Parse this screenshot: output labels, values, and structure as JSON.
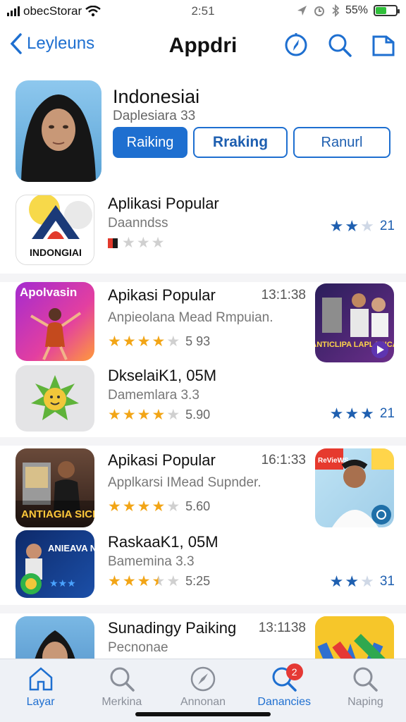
{
  "status": {
    "carrier": "obecStorar",
    "time": "2:51",
    "battery": "55%"
  },
  "nav": {
    "back_label": "Leyleuns",
    "title": "Appdri",
    "icons": [
      "compass-icon",
      "search-icon",
      "share-icon"
    ]
  },
  "hero": {
    "name": "Indonesiai",
    "subtitle": "Daplesiara 33",
    "buttons": [
      "Raiking",
      "Rraking",
      "Ranurl"
    ]
  },
  "rows": [
    {
      "icon_text": "INDONGIAI",
      "title": "Aplikasi Popular",
      "subtitle": "Daanndss",
      "stars": 0,
      "right_rating_stars": 2,
      "right_rating_value": "21"
    },
    {
      "icon_text": "Apolvasin",
      "title": "Apikasi Popular",
      "time": "13:1:38",
      "subtitle": "Anpieolana Mead Rmpuian.",
      "stars": 4,
      "rating": "5 93",
      "right_icon_text": "ANTICLIPA LAPLASICA"
    },
    {
      "title": "DkselaiK1, 05M",
      "subtitle": "Damemlara 3.3",
      "stars": 4,
      "rating": "5.90",
      "right_rating_stars": 3,
      "right_rating_value": "21"
    },
    {
      "icon_text": "ANTIAGIA SICNCKS",
      "title": "Apikasi Popular",
      "time": "16:1:33",
      "subtitle": "Applkarsi IMead Supnder.",
      "stars": 4,
      "rating": "5.60",
      "right_icon_text": "ReVieWS"
    },
    {
      "icon_text": "ANIEAVA NABL",
      "title": "RaskaaK1, 05M",
      "subtitle": "Bamemina 3.3",
      "stars": 3.5,
      "rating": "5:25",
      "right_rating_stars": 2,
      "right_rating_value": "31"
    },
    {
      "title": "Sunadingy Paiking",
      "time": "13:1138",
      "subtitle": "Pecnonae"
    }
  ],
  "tabs": [
    {
      "label": "Layar",
      "icon": "home-icon",
      "active": true
    },
    {
      "label": "Merkina",
      "icon": "search-icon",
      "active": false
    },
    {
      "label": "Annonan",
      "icon": "compass-icon",
      "active": false
    },
    {
      "label": "Danancies",
      "icon": "search-icon",
      "active": true,
      "badge": "2"
    },
    {
      "label": "Naping",
      "icon": "search-icon",
      "active": false
    }
  ],
  "colors": {
    "accent": "#1e6fd0",
    "star": "#f2a516",
    "badge": "#e53935"
  }
}
